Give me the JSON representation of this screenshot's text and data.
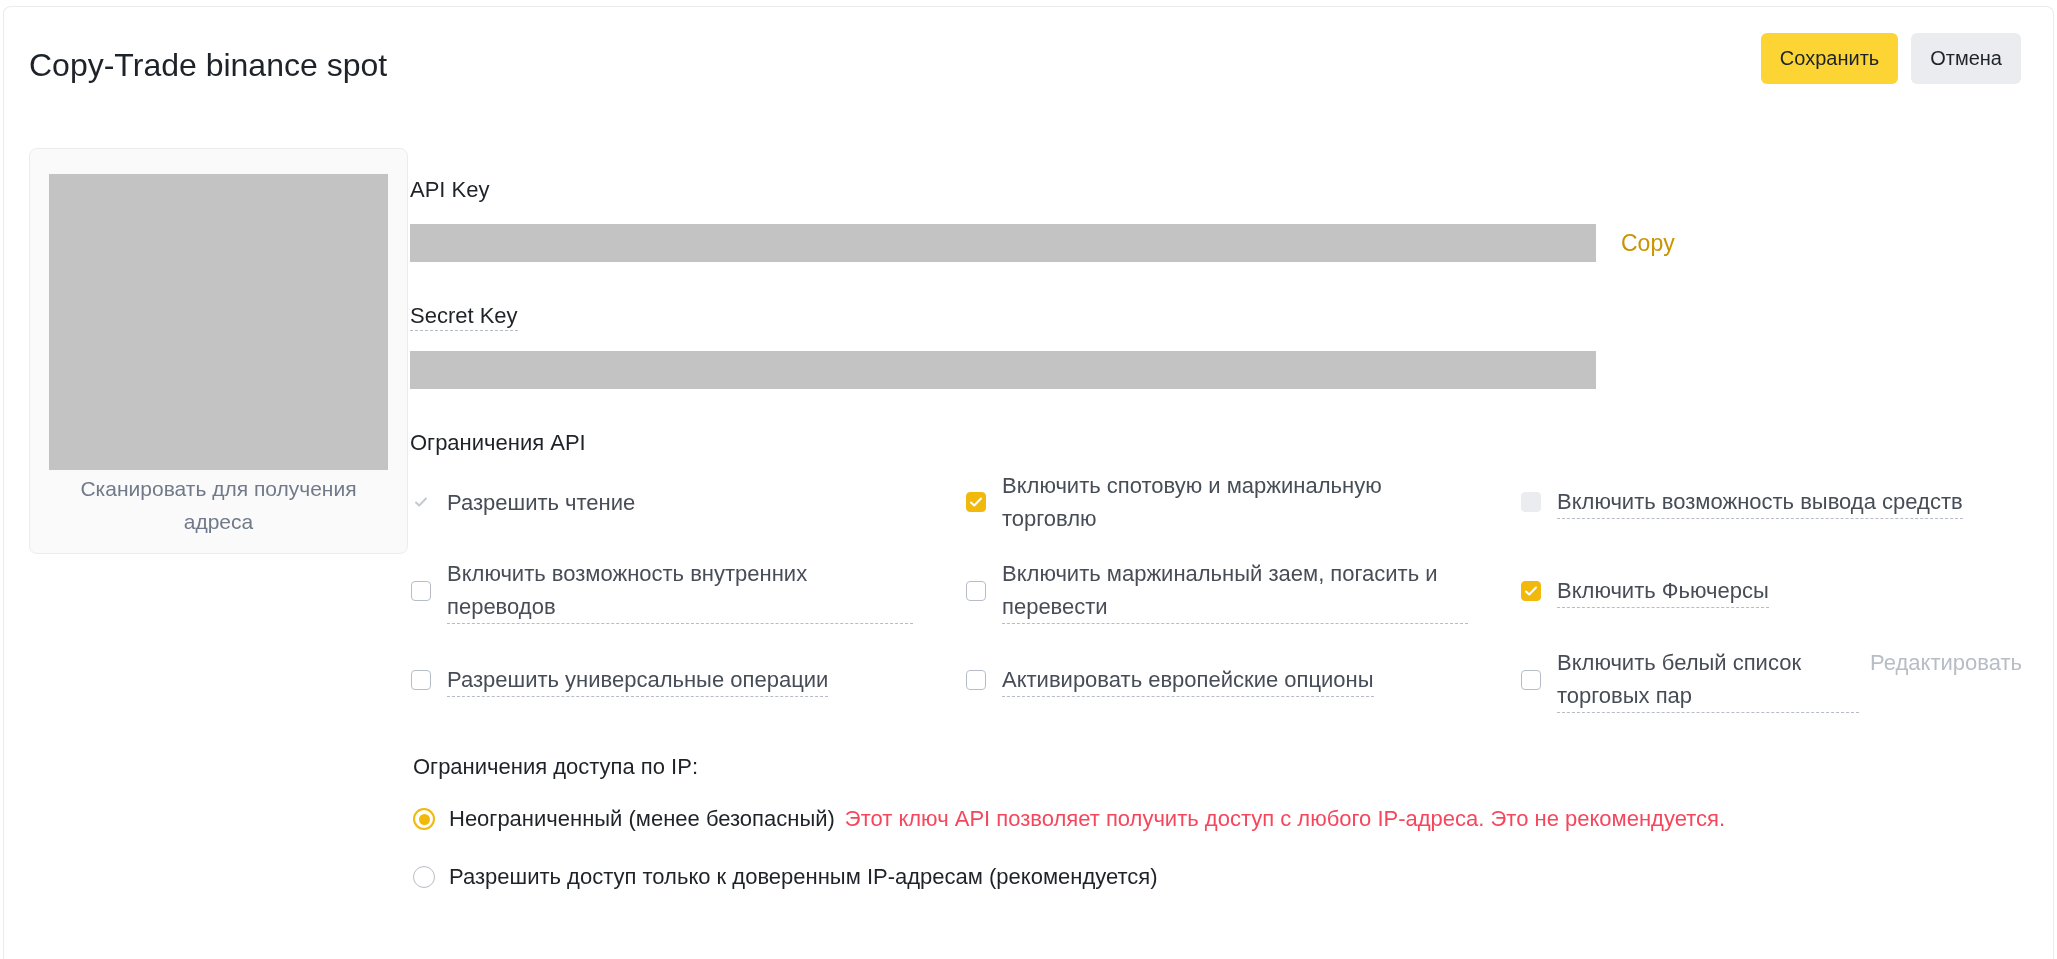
{
  "header": {
    "title": "Copy-Trade binance spot",
    "buttons": [
      {
        "label": "Сохранить",
        "kind": "primary"
      },
      {
        "label": "Отмена",
        "kind": "secondary"
      }
    ]
  },
  "qr_panel": {
    "caption": "Сканировать для получения адреса"
  },
  "api_key": {
    "label": "API Key",
    "has_tooltip": false,
    "copy_link": "Copy"
  },
  "secret_key": {
    "label": "Secret Key",
    "has_tooltip": true
  },
  "api_restrictions": {
    "title": "Ограничения API",
    "options": [
      {
        "label": "Разрешить чтение",
        "checked": true,
        "disabled": true,
        "has_tooltip": false
      },
      {
        "label": "Включить спотовую и маржинальную торговлю",
        "checked": true,
        "disabled": false,
        "has_tooltip": false
      },
      {
        "label": "Включить возможность вывода средств",
        "checked": false,
        "disabled": true,
        "has_tooltip": true
      },
      {
        "label": "Включить возможность внутренних переводов",
        "checked": false,
        "disabled": false,
        "has_tooltip": true
      },
      {
        "label": "Включить маржинальный заем, погасить и перевести",
        "checked": false,
        "disabled": false,
        "has_tooltip": true
      },
      {
        "label": "Включить Фьючерсы",
        "checked": true,
        "disabled": false,
        "has_tooltip": true
      },
      {
        "label": "Разрешить универсальные операции",
        "checked": false,
        "disabled": false,
        "has_tooltip": true
      },
      {
        "label": "Активировать европейские опционы",
        "checked": false,
        "disabled": false,
        "has_tooltip": true
      },
      {
        "label": "Включить белый список торговых пар",
        "checked": false,
        "disabled": false,
        "has_tooltip": true,
        "edit_link": {
          "label": "Редактировать",
          "disabled": true
        }
      }
    ]
  },
  "ip_restrictions": {
    "title": "Ограничения доступа по IP:",
    "options": [
      {
        "label": "Неограниченный (менее безопасный)",
        "selected": true,
        "warning": "Этот ключ API позволяет получить доступ с любого IP-адреса. Это не рекомендуется."
      },
      {
        "label": "Разрешить доступ только к доверенным IP-адресам (рекомендуется)",
        "selected": false
      }
    ]
  }
}
